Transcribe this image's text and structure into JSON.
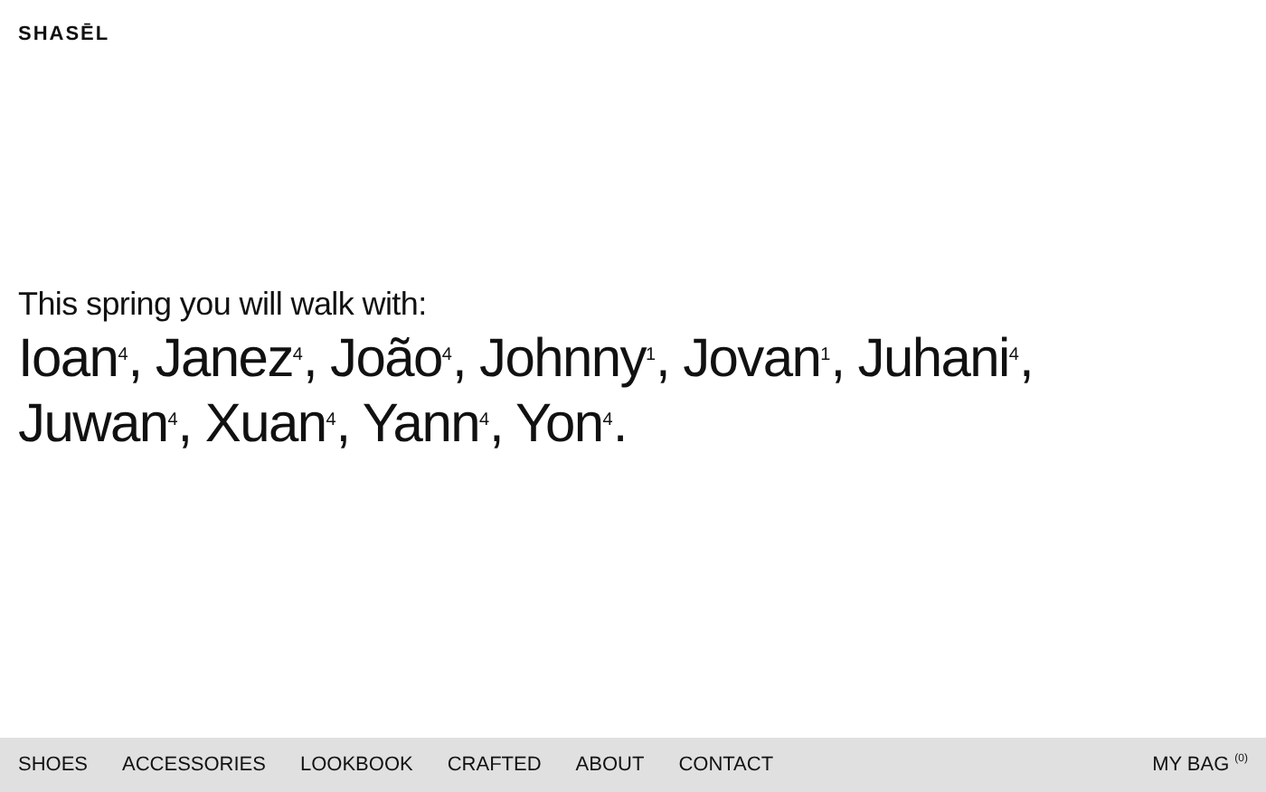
{
  "logo": "SHASĒL",
  "intro": "This spring you will walk with:",
  "names": "Ioan$^{4}$, Janez$^{4}$, João$^{4}$, Johnny$^{1}$, Jovan$^{1}$, Juhani$^{4}$, Juwan$^{4}$, Xuan$^{4}$, Yann$^{4}$, Yon$^{4}$.",
  "nav": [
    "SHOES",
    "ACCESSORIES",
    "LOOKBOOK",
    "CRAFTED",
    "ABOUT",
    "CONTACT"
  ],
  "bag": {
    "label": "MY BAG",
    "count": "(0)"
  }
}
